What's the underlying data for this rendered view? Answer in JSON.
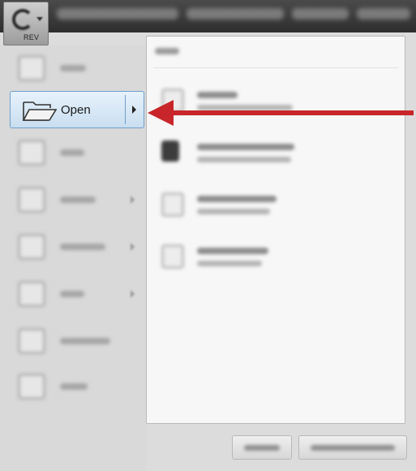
{
  "app": {
    "badge_label": "REV",
    "title": ""
  },
  "left_menu": {
    "items": [
      {
        "label": "",
        "icon": "new-icon",
        "has_submenu": false
      },
      {
        "label": "Open",
        "icon": "folder-open-icon",
        "has_submenu": true,
        "selected": true
      },
      {
        "label": "",
        "icon": "save-icon",
        "has_submenu": false
      },
      {
        "label": "",
        "icon": "save-as-icon",
        "has_submenu": true
      },
      {
        "label": "",
        "icon": "security-icon",
        "has_submenu": true
      },
      {
        "label": "",
        "icon": "print-icon",
        "has_submenu": true
      },
      {
        "label": "",
        "icon": "send-email-icon",
        "has_submenu": false
      },
      {
        "label": "",
        "icon": "close-icon",
        "has_submenu": false
      }
    ]
  },
  "submenu": {
    "header": "",
    "items": [
      {
        "title": "",
        "subtitle": "",
        "icon": "open-file-icon"
      },
      {
        "title": "",
        "subtitle": "",
        "icon": "open-from-cloud-icon"
      },
      {
        "title": "",
        "subtitle": "",
        "icon": "import-file-icon"
      },
      {
        "title": "",
        "subtitle": "",
        "icon": "import-file-icon"
      }
    ]
  },
  "bottom_buttons": [
    {
      "label": ""
    },
    {
      "label": ""
    }
  ],
  "colors": {
    "highlight_border": "#6f9fcb",
    "highlight_fill": "#c9def0",
    "annotation_arrow": "#c8262a"
  }
}
